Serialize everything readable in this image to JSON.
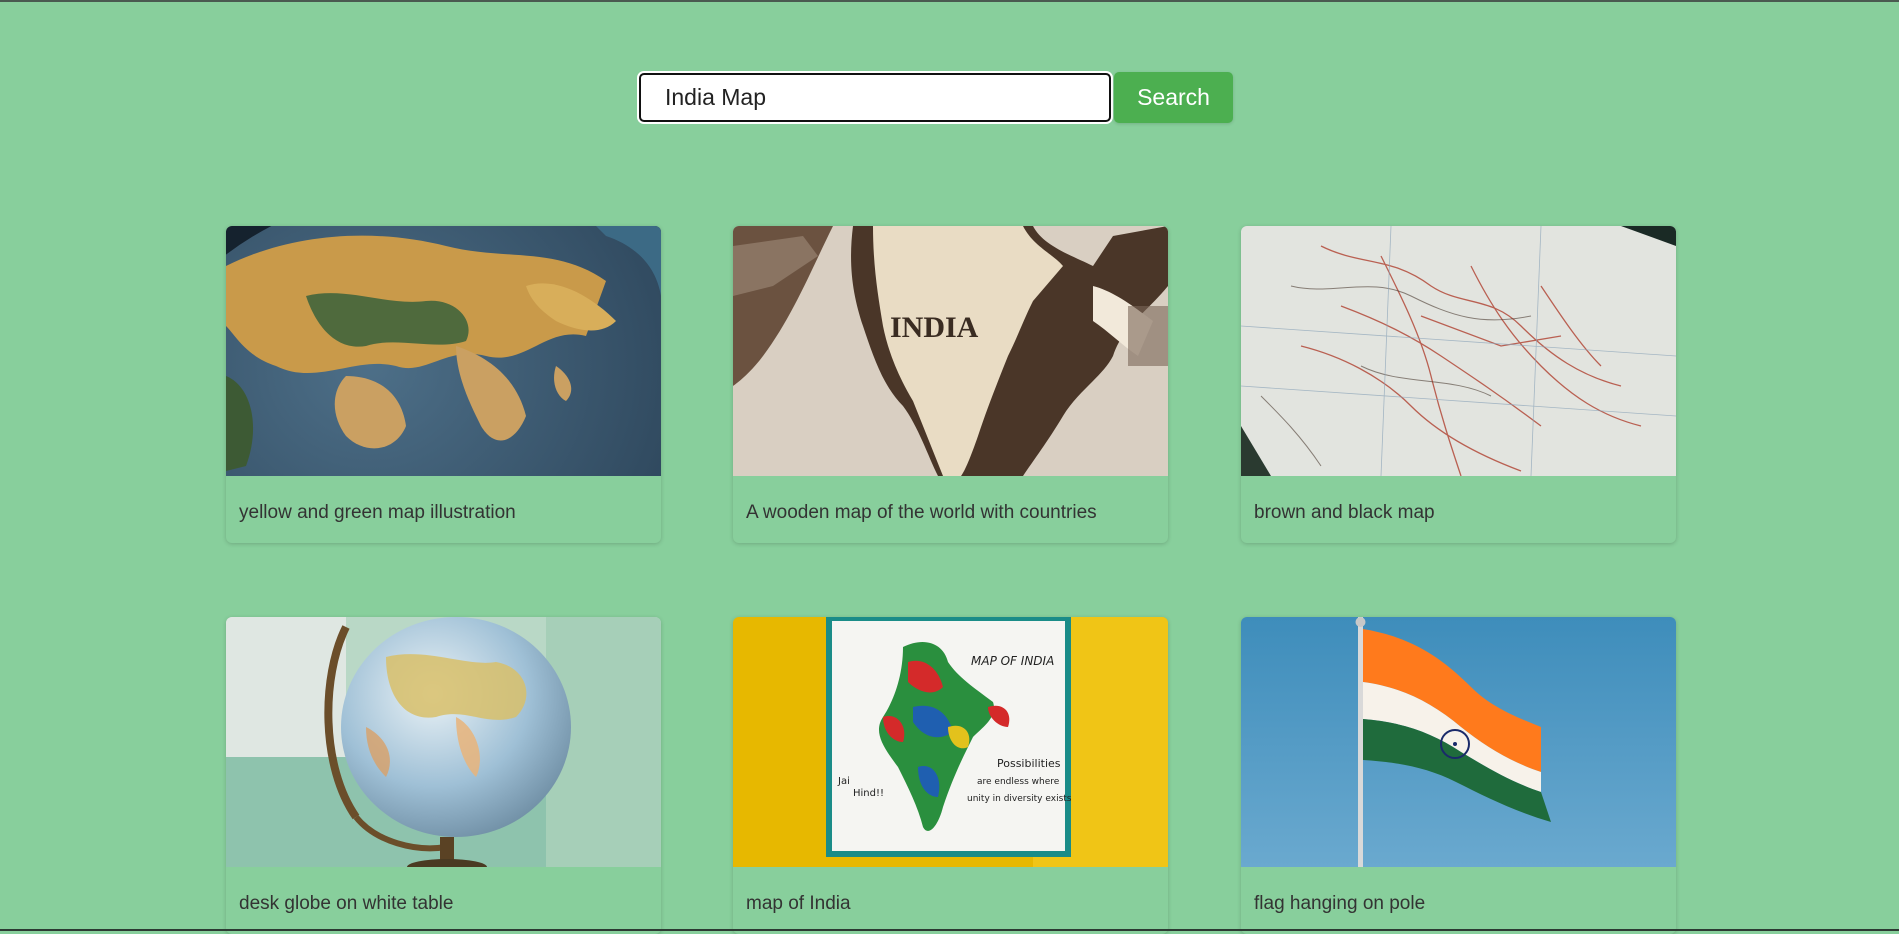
{
  "search": {
    "value": "India Map",
    "button_label": "Search"
  },
  "results": [
    {
      "caption": "yellow and green map illustration",
      "image": "globe-closeup-image"
    },
    {
      "caption": "A wooden map of the world with countries",
      "image": "wooden-map-image",
      "image_text": "INDIA"
    },
    {
      "caption": "brown and black map",
      "image": "paper-map-image"
    },
    {
      "caption": "desk globe on white table",
      "image": "desk-globe-image"
    },
    {
      "caption": "map of India",
      "image": "india-poster-image",
      "image_text": "MAP OF INDIA"
    },
    {
      "caption": "flag hanging on pole",
      "image": "indian-flag-image"
    }
  ]
}
